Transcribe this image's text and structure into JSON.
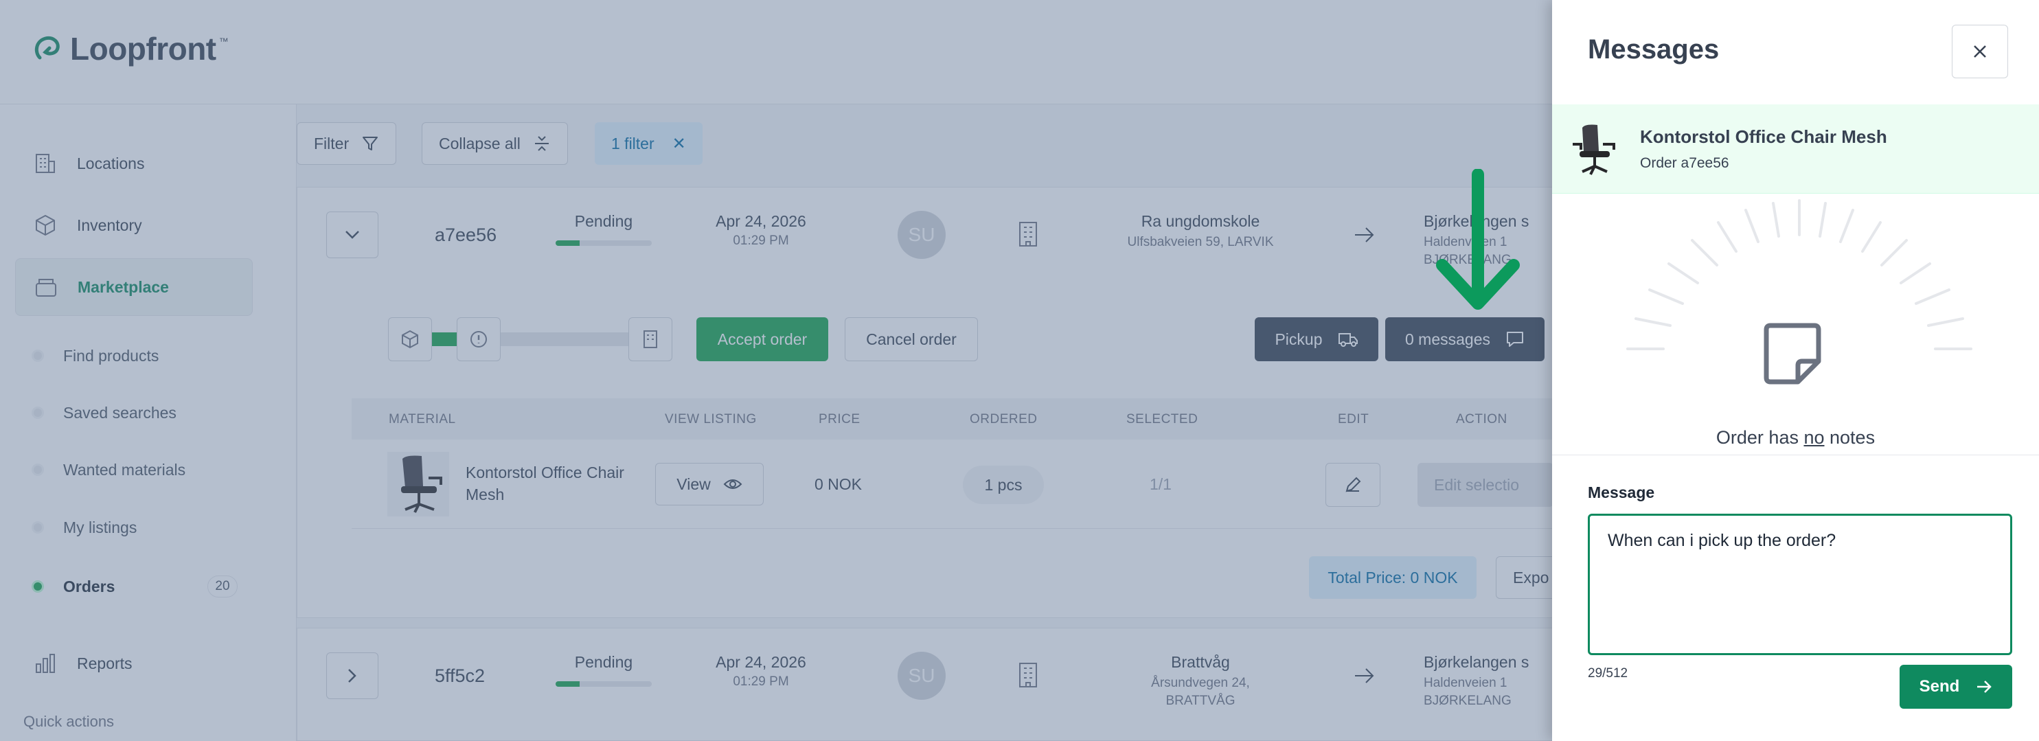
{
  "app": {
    "logo": "Loopfront",
    "logo_tm": "™"
  },
  "sidebar": {
    "items": [
      {
        "label": "Locations",
        "icon": "building-icon"
      },
      {
        "label": "Inventory",
        "icon": "box-icon"
      },
      {
        "label": "Marketplace",
        "icon": "marketplace-icon",
        "active": true
      }
    ],
    "sub_items": [
      {
        "label": "Find products"
      },
      {
        "label": "Saved searches"
      },
      {
        "label": "Wanted materials"
      },
      {
        "label": "My listings"
      },
      {
        "label": "Orders",
        "badge": "20",
        "active": true
      }
    ],
    "reports": "Reports",
    "quick_actions": "Quick actions"
  },
  "toolbar": {
    "filter": "Filter",
    "collapse_all": "Collapse all",
    "filter_chip": "1 filter"
  },
  "orders": [
    {
      "id": "a7ee56",
      "status": "Pending",
      "progress": 0.25,
      "date": "Apr 24, 2026",
      "time": "01:29 PM",
      "avatar": "SU",
      "from_name": "Ra ungdomskole",
      "from_addr": "Ulfsbakveien 59, LARVIK",
      "to_name": "Bjørkelangen s",
      "to_addr_1": "Haldenveien 1",
      "to_addr_2": "BJØRKELANG"
    },
    {
      "id": "5ff5c2",
      "status": "Pending",
      "progress": 0.25,
      "date": "Apr 24, 2026",
      "time": "01:29 PM",
      "avatar": "SU",
      "from_name": "Brattvåg",
      "from_addr": "Årsundvegen 24,",
      "from_addr_2": "BRATTVÅG",
      "to_name": "Bjørkelangen s",
      "to_addr_1": "Haldenveien 1",
      "to_addr_2": "BJØRKELANG"
    }
  ],
  "order_actions": {
    "accept": "Accept order",
    "cancel": "Cancel order",
    "pickup": "Pickup",
    "messages": "0 messages"
  },
  "table": {
    "headers": [
      "MATERIAL",
      "VIEW LISTING",
      "PRICE",
      "ORDERED",
      "SELECTED",
      "EDIT",
      "ACTION"
    ],
    "row": {
      "material": "Kontorstol Office Chair Mesh",
      "view": "View",
      "price": "0 NOK",
      "ordered": "1 pcs",
      "selected": "1/1",
      "action": "Edit selectio"
    }
  },
  "totals": {
    "total_price": "Total Price: 0 NOK",
    "export": "Expo"
  },
  "drawer": {
    "title": "Messages",
    "product_name": "Kontorstol Office Chair Mesh",
    "order_ref": "Order a7ee56",
    "no_notes_pre": "Order has ",
    "no_notes_em": "no",
    "no_notes_post": " notes",
    "message_label": "Message",
    "message_value": "When can i pick up the order?",
    "char_count": "29/512",
    "send": "Send"
  },
  "colors": {
    "brand": "#0f8a5f",
    "overlay": "#5e7495",
    "annotation_arrow": "#0c9a5c"
  }
}
